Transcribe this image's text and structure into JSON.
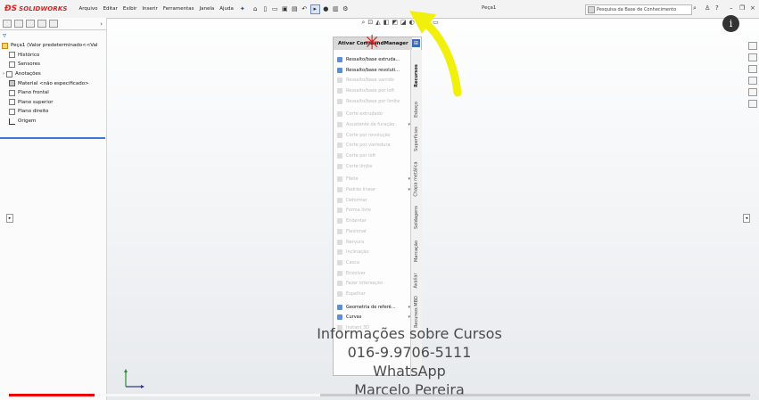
{
  "app": {
    "logo_ds": "ĐS",
    "logo_text": "SOLIDWORKS",
    "doc_title": "Peça1",
    "search_placeholder": "Pesquisa da Base de Conhecimento",
    "info_icon": "i"
  },
  "menu": [
    "Arquivo",
    "Editar",
    "Exibir",
    "Inserir",
    "Ferramentas",
    "Janela",
    "Ajuda"
  ],
  "tree": {
    "root": "Peça1  (Valor predeterminado<<Val",
    "items": [
      "Histórico",
      "Sensores",
      "Anotações",
      "Material <não especificado>",
      "Plano frontal",
      "Plano superior",
      "Plano direito",
      "Origem"
    ]
  },
  "command_manager": {
    "title": "Ativar CommandManager",
    "items": [
      {
        "label": "Ressalto/base extruda...",
        "enabled": true
      },
      {
        "label": "Ressalto/base revoluti...",
        "enabled": true
      },
      {
        "label": "Ressalto/base varrido",
        "enabled": false
      },
      {
        "label": "Ressalto/base por loft",
        "enabled": false
      },
      {
        "label": "Ressalto/base por limite",
        "enabled": false
      },
      {
        "label": "Corte extrudado",
        "enabled": false
      },
      {
        "label": "Assistente de furação",
        "enabled": false
      },
      {
        "label": "Corte por revolução",
        "enabled": false
      },
      {
        "label": "Corte por varredura",
        "enabled": false
      },
      {
        "label": "Corte por loft",
        "enabled": false
      },
      {
        "label": "Corte limite",
        "enabled": false
      },
      {
        "label": "Filete",
        "enabled": false
      },
      {
        "label": "Padrão linear",
        "enabled": false
      },
      {
        "label": "Deformar",
        "enabled": false
      },
      {
        "label": "Forma livre",
        "enabled": false
      },
      {
        "label": "Endentar",
        "enabled": false
      },
      {
        "label": "Flexionar",
        "enabled": false
      },
      {
        "label": "Nervura",
        "enabled": false
      },
      {
        "label": "Inclinação",
        "enabled": false
      },
      {
        "label": "Casca",
        "enabled": false
      },
      {
        "label": "Envolver",
        "enabled": false
      },
      {
        "label": "Fazer interseção",
        "enabled": false
      },
      {
        "label": "Espelhar",
        "enabled": false
      },
      {
        "label": "Geometria de referê...",
        "enabled": true
      },
      {
        "label": "Curvas",
        "enabled": true
      },
      {
        "label": "Instant 3D",
        "enabled": false
      }
    ],
    "tabs": [
      "Recursos",
      "Esboço",
      "Superfícies",
      "Chapa metálica",
      "Soldagens",
      "Marcação",
      "Avaliar",
      "Recursos MBD"
    ]
  },
  "overlay": {
    "line1": "Informações sobre Cursos",
    "line2": "016-9.9706-5111",
    "line3": "WhatsApp",
    "line4": "Marcelo Pereira"
  },
  "video": {
    "progress": 0.115,
    "buffered": 0.42
  },
  "colors": {
    "accent": "#3a7bd5",
    "arrow": "#f1ef0c",
    "marker": "#d41a1a",
    "progress": "#e00000"
  }
}
